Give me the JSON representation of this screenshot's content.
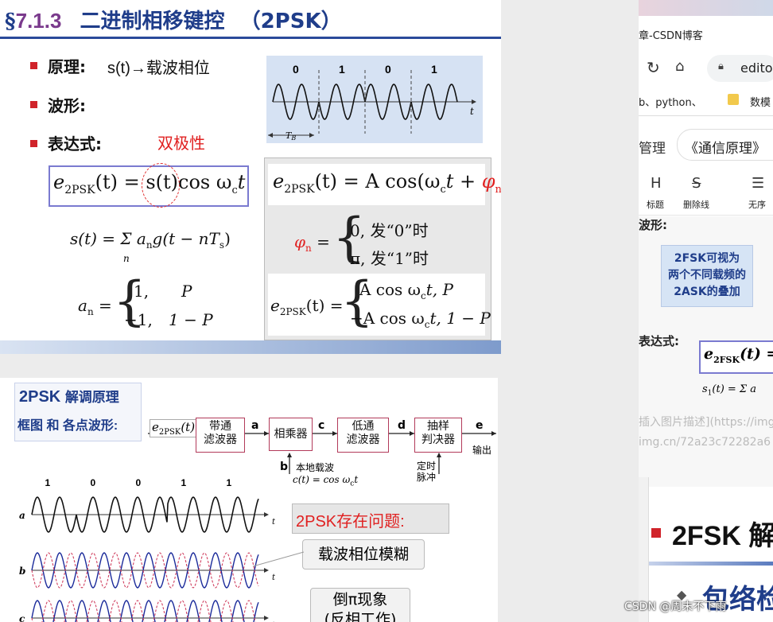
{
  "slide_top": {
    "title_section": "§",
    "title_number": "7.1.3",
    "title_text": "二进制相移键控",
    "title_paren": "（2PSK）",
    "bullet1_label": "原理:",
    "bullet1_text": "s(t)→载波相位",
    "bullet2_label": "波形:",
    "bullet3_label": "表达式:",
    "annot_bipolar": "双极性",
    "wave_bits": [
      "0",
      "1",
      "0",
      "1"
    ],
    "wave_axis_t": "t",
    "wave_tb": "T",
    "wave_tb_sub": "B",
    "f_e2psk": "e",
    "f_sub_2psk": "2PSK",
    "f_e2psk_st": "(t) = s(t)cos ω",
    "f_wc_sub": "c",
    "f_t": "t",
    "f_s_sum": "s(t) = Σ a",
    "f_n": "n",
    "f_g": "g(t − nT",
    "f_s": "s",
    "f_close": ")",
    "f_an": "a",
    "f_an_eq": "=",
    "f_an_case1_val": "1,",
    "f_an_case1_prob": "P",
    "f_an_case2_val": "−1,",
    "f_an_case2_prob": "1 − P",
    "f_right1": "(t) = A cos(ω",
    "f_right1_tail": "t + ",
    "f_phi": "φ",
    "f_phi_eq": "=",
    "f_phi_case1": "0,   发“0”时",
    "f_phi_case2": "π,   发“1”时",
    "f_right3_case1": "A cos ω",
    "f_right3_case1_tail": "t,    P",
    "f_right3_case2": "−A cos ω",
    "f_right3_case2_tail": "t,   1 − P"
  },
  "slide_bottom": {
    "heading1": "2PSK",
    "heading1_cn": "解调原理",
    "heading2": "框图 和 各点波形:",
    "input_e": "e",
    "input_sub": "2PSK",
    "input_tail": "(t)",
    "block1": "带通\n滤波器",
    "block2": "相乘器",
    "block3": "低通\n滤波器",
    "block4": "抽样\n判决器",
    "pt_a": "a",
    "pt_b": "b",
    "pt_c": "c",
    "pt_d": "d",
    "pt_e": "e",
    "output_label": "输出",
    "local_carrier": "本地载波",
    "local_carrier_eq": "c(t) = cos ω",
    "local_carrier_sub": "c",
    "local_carrier_tail": "t",
    "timing_pulse": "定时\n脉冲",
    "bits": [
      "1",
      "0",
      "0",
      "1",
      "1"
    ],
    "row_labels": [
      "a",
      "b",
      "c"
    ],
    "axis_t": "t",
    "problem_title": "2PSK存在问题:",
    "callout1": "载波相位模糊",
    "callout2_line1": "倒π现象",
    "callout2_line2": "(反相工作)"
  },
  "right_panel": {
    "tab_title": "章-CSDN博客",
    "address_text": "edito",
    "bookmark1": "b、python、",
    "bookmark2": "数模",
    "manage": "管理",
    "doc_title": "《通信原理》",
    "tool_h": "H",
    "tool_h_label": "标题",
    "tool_s": "S",
    "tool_s_label": "删除线",
    "tool_list_label": "无序",
    "section_wave": "波形:",
    "fsk_box": "2FSK可视为\n两个不同载频的\n2ASK的叠加",
    "section_expr": "表达式:",
    "fsk_formula": "e",
    "fsk_formula_sub": "2FSK",
    "fsk_formula_tail": "(t) =",
    "fsk_s1": "s",
    "fsk_s1_sub": "1",
    "fsk_s1_tail": "(t) = Σ a",
    "md_text1": "插入图片描述](https://img",
    "md_text2": "img.cn/72a23c72282a6",
    "heading_2fsk": "2FSK 解",
    "heading_env": "包络检",
    "watermark": "CSDN @周末不下雨"
  },
  "colors": {
    "title_blue": "#1f3d8a",
    "bullet_red": "#d0232a",
    "accent_red": "#e02020",
    "sine_black": "#111111",
    "sine_red_dashed": "#d04060",
    "sine_blue": "#1a2a9a"
  }
}
